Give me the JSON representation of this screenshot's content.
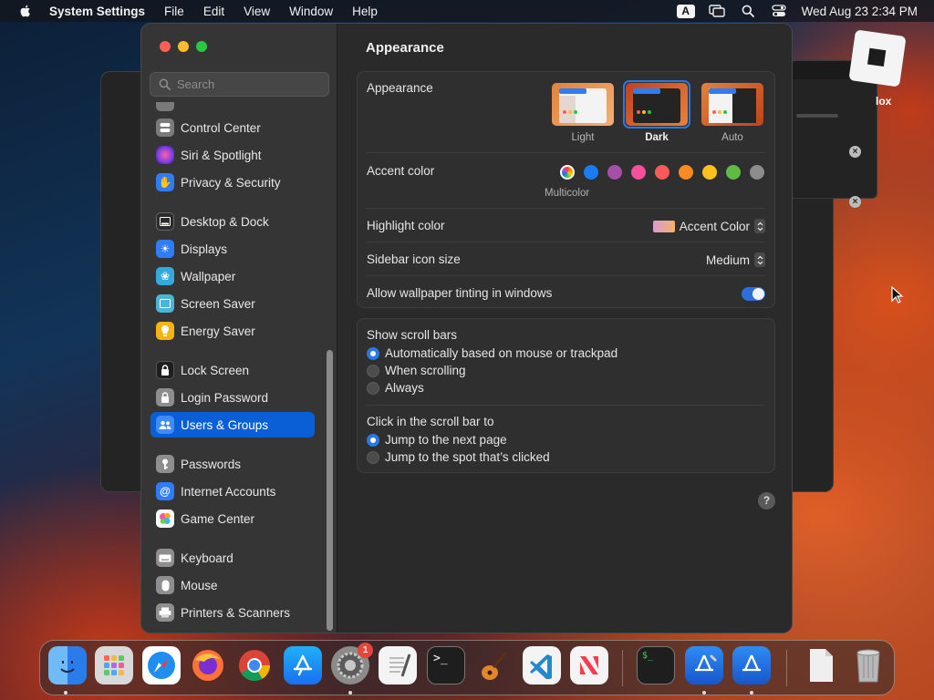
{
  "menubar": {
    "app_name": "System Settings",
    "menus": [
      "File",
      "Edit",
      "View",
      "Window",
      "Help"
    ],
    "input_source": "A",
    "clock": "Wed Aug 23  2:34 PM"
  },
  "desktop": {
    "file_label": "lox"
  },
  "sidebar": {
    "search_placeholder": "Search",
    "items": [
      {
        "label": "Control Center",
        "icon": "control-center-icon",
        "color": "#7a7a7a"
      },
      {
        "label": "Siri & Spotlight",
        "icon": "siri-icon",
        "color": "#b43bd6"
      },
      {
        "label": "Privacy & Security",
        "icon": "hand-icon",
        "color": "#2f7cf6"
      },
      {
        "label": "Desktop & Dock",
        "icon": "dock-icon",
        "color": "#2b2b2b"
      },
      {
        "label": "Displays",
        "icon": "sun-icon",
        "color": "#2f7cf6"
      },
      {
        "label": "Wallpaper",
        "icon": "wallpaper-icon",
        "color": "#34aadc"
      },
      {
        "label": "Screen Saver",
        "icon": "screen-saver-icon",
        "color": "#4ab5d8"
      },
      {
        "label": "Energy Saver",
        "icon": "bulb-icon",
        "color": "#f5b316"
      },
      {
        "label": "Lock Screen",
        "icon": "lock-icon",
        "color": "#2b2b2b"
      },
      {
        "label": "Login Password",
        "icon": "padlock-icon",
        "color": "#8e8e8e"
      },
      {
        "label": "Users & Groups",
        "icon": "users-icon",
        "color": "#3d8cf7"
      },
      {
        "label": "Passwords",
        "icon": "key-icon",
        "color": "#8e8e8e"
      },
      {
        "label": "Internet Accounts",
        "icon": "at-icon",
        "color": "#2f7cf6"
      },
      {
        "label": "Game Center",
        "icon": "game-center-icon",
        "color": "#ffffff"
      },
      {
        "label": "Keyboard",
        "icon": "keyboard-icon",
        "color": "#8e8e8e"
      },
      {
        "label": "Mouse",
        "icon": "mouse-icon",
        "color": "#8e8e8e"
      },
      {
        "label": "Printers & Scanners",
        "icon": "printer-icon",
        "color": "#8e8e8e"
      }
    ],
    "selected": "Users & Groups"
  },
  "content": {
    "title": "Appearance",
    "appearance": {
      "label": "Appearance",
      "options": [
        {
          "label": "Light",
          "selected": false
        },
        {
          "label": "Dark",
          "selected": true
        },
        {
          "label": "Auto",
          "selected": false
        }
      ]
    },
    "accent": {
      "label": "Accent color",
      "selected_label": "Multicolor",
      "colors": [
        "multicolor",
        "#1a7cf5",
        "#a550a7",
        "#f74f9e",
        "#f85a5a",
        "#f88b22",
        "#fcc21c",
        "#62ba46",
        "#8c8c8c"
      ]
    },
    "highlight": {
      "label": "Highlight color",
      "value": "Accent Color"
    },
    "sidebar_icon_size": {
      "label": "Sidebar icon size",
      "value": "Medium"
    },
    "tinting": {
      "label": "Allow wallpaper tinting in windows",
      "enabled": true
    },
    "scroll_bars": {
      "label": "Show scroll bars",
      "options": [
        {
          "label": "Automatically based on mouse or trackpad",
          "selected": true
        },
        {
          "label": "When scrolling",
          "selected": false
        },
        {
          "label": "Always",
          "selected": false
        }
      ]
    },
    "click_scroll": {
      "label": "Click in the scroll bar to",
      "options": [
        {
          "label": "Jump to the next page",
          "selected": true
        },
        {
          "label": "Jump to the spot that’s clicked",
          "selected": false
        }
      ]
    },
    "help": "?"
  },
  "dock": {
    "apps": [
      {
        "name": "finder-icon",
        "color": "#3b8ff5"
      },
      {
        "name": "launchpad-icon",
        "color": "#d9d9d9"
      },
      {
        "name": "safari-icon",
        "color": "#1f8ef1"
      },
      {
        "name": "firefox-icon",
        "color": "#ff7139"
      },
      {
        "name": "chrome-icon",
        "color": "#f2f2f2"
      },
      {
        "name": "app-store-icon",
        "color": "#1d8bf1"
      },
      {
        "name": "system-settings-icon",
        "color": "#8b8b8b"
      },
      {
        "name": "textedit-icon",
        "color": "#f4f4f4"
      },
      {
        "name": "terminal-icon",
        "color": "#1e1e1e"
      },
      {
        "name": "garageband-icon",
        "color": "#f0a030"
      },
      {
        "name": "vscode-icon",
        "color": "#f4f4f4"
      },
      {
        "name": "news-icon",
        "color": "#f4f4f4"
      },
      {
        "name": "terminal-icon-2",
        "color": "#1e1e1e"
      },
      {
        "name": "xcode-icon",
        "color": "#2b6fd6"
      },
      {
        "name": "instruments-icon",
        "color": "#2b6fd6"
      },
      {
        "name": "document-icon",
        "color": "#efefef"
      },
      {
        "name": "trash-icon",
        "color": "#9a9a9a"
      }
    ],
    "settings_badge": "1"
  }
}
